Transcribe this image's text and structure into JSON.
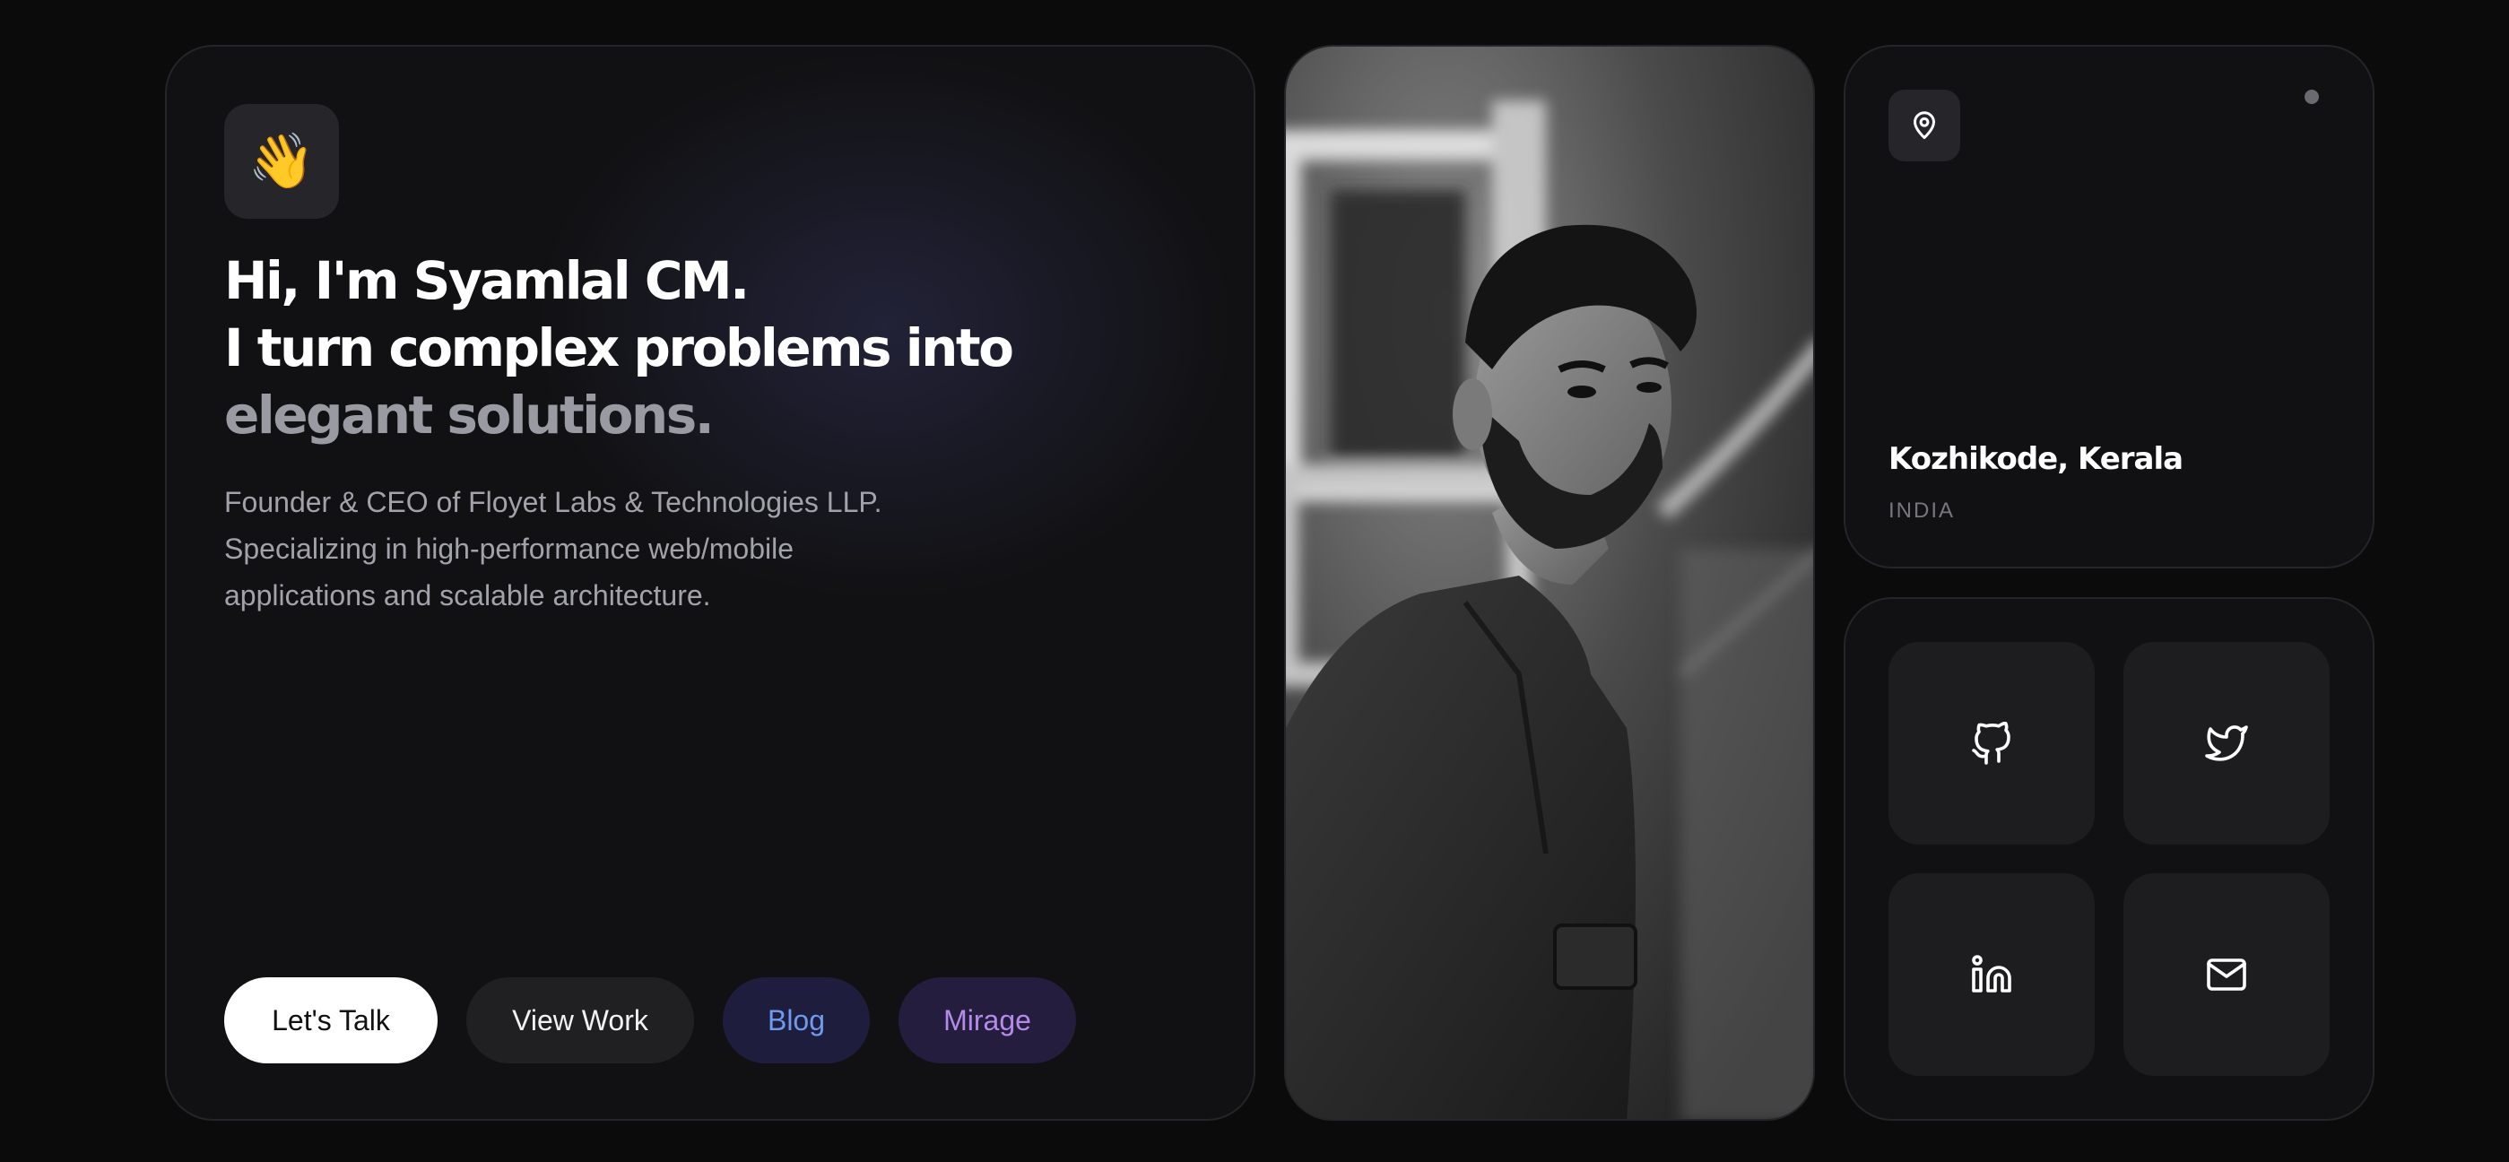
{
  "hero": {
    "emoji": "👋",
    "headline_line1": "Hi, I'm Syamlal CM.",
    "headline_line2_start": "I turn complex problems into ",
    "headline_highlight": "elegant solutions.",
    "bio": "Founder & CEO of Floyet Labs & Technologies LLP. Specializing in high-performance web/mobile applications and scalable architecture.",
    "buttons": {
      "talk": "Let's Talk",
      "work": "View Work",
      "blog": "Blog",
      "mirage": "Mirage"
    }
  },
  "photo": {
    "icon": "portrait-photo"
  },
  "location": {
    "icon": "map-pin-icon",
    "city": "Kozhikode, Kerala",
    "country": "INDIA"
  },
  "social": {
    "icons": [
      "github-icon",
      "twitter-icon",
      "linkedin-icon",
      "mail-icon"
    ]
  },
  "colors": {
    "background": "#0b0b0c",
    "card": "#111113",
    "blog_text": "#6f9bec",
    "mirage_text": "#b48be6",
    "muted_highlight": "#9a9aa3"
  }
}
